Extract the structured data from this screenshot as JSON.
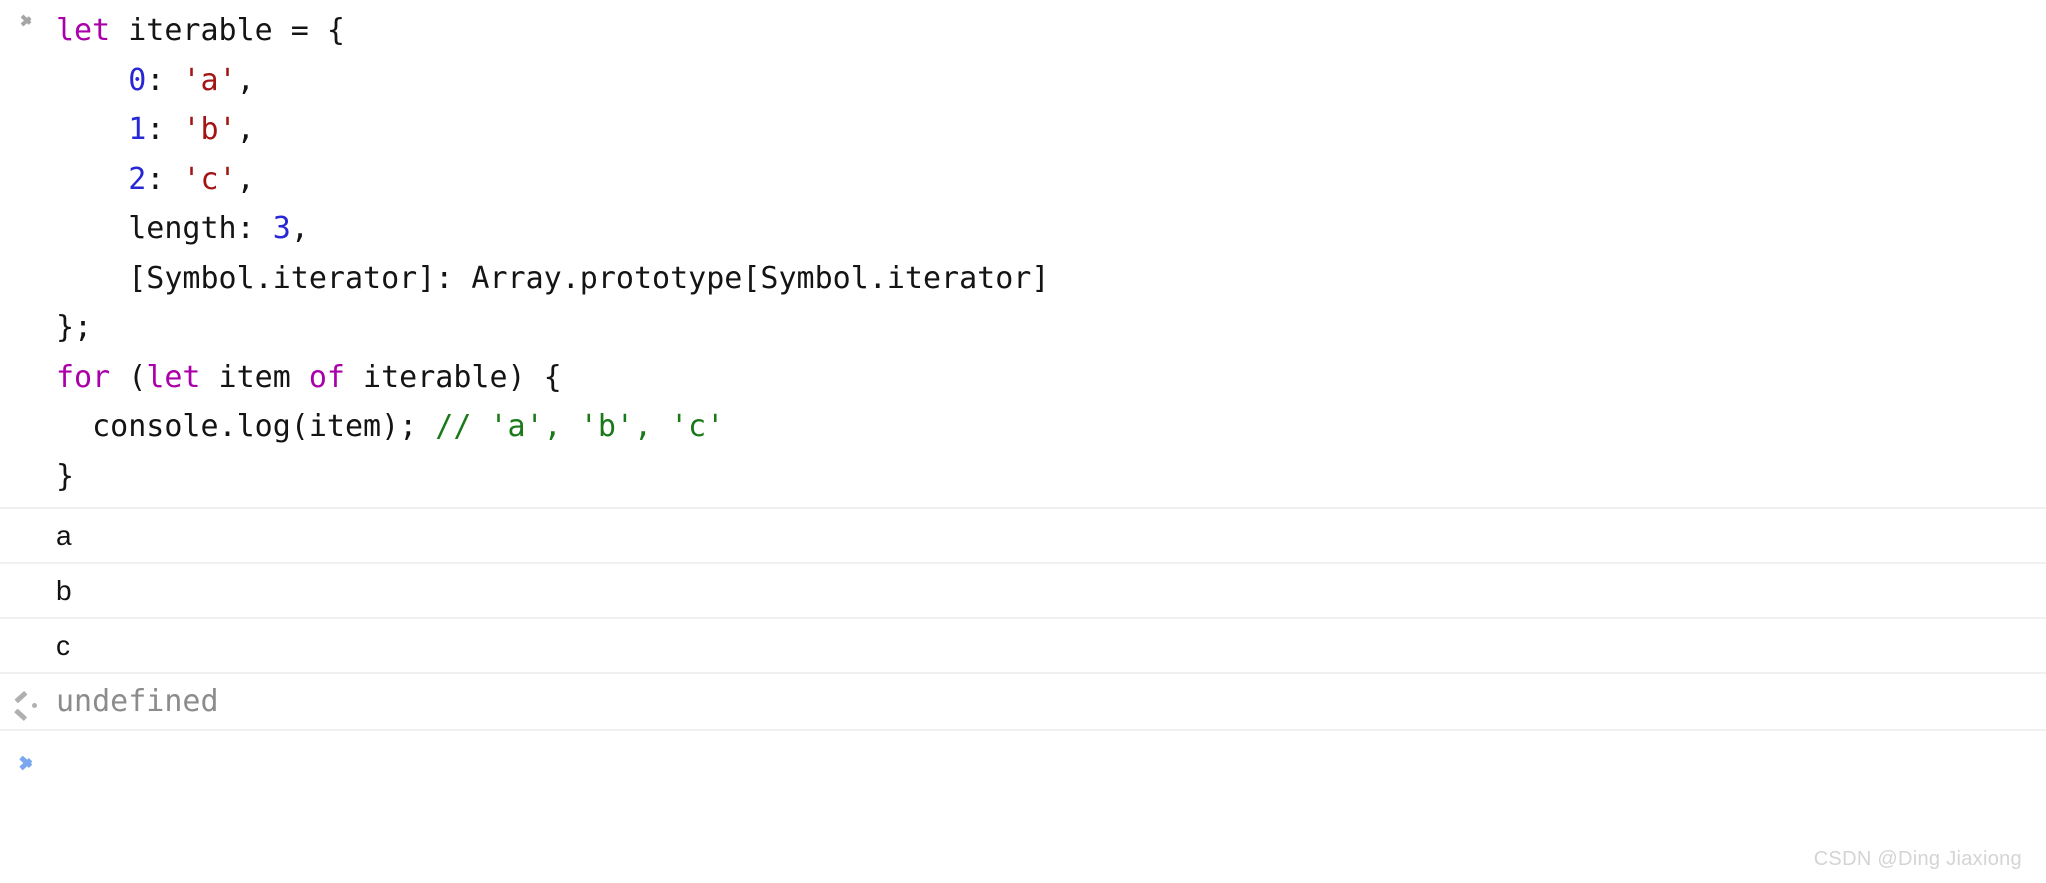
{
  "console": {
    "prompt_icon": "chevron-right-icon",
    "result_icon": "arrow-left-return-icon",
    "command_entry": {
      "icon": "chevron-right-icon",
      "lines": [
        [
          {
            "t": "let",
            "c": "keyword"
          },
          {
            "t": " iterable = {",
            "c": "plain"
          }
        ],
        [
          {
            "t": "    ",
            "c": "plain"
          },
          {
            "t": "0",
            "c": "number"
          },
          {
            "t": ": ",
            "c": "plain"
          },
          {
            "t": "'a'",
            "c": "string"
          },
          {
            "t": ",",
            "c": "plain"
          }
        ],
        [
          {
            "t": "    ",
            "c": "plain"
          },
          {
            "t": "1",
            "c": "number"
          },
          {
            "t": ": ",
            "c": "plain"
          },
          {
            "t": "'b'",
            "c": "string"
          },
          {
            "t": ",",
            "c": "plain"
          }
        ],
        [
          {
            "t": "    ",
            "c": "plain"
          },
          {
            "t": "2",
            "c": "number"
          },
          {
            "t": ": ",
            "c": "plain"
          },
          {
            "t": "'c'",
            "c": "string"
          },
          {
            "t": ",",
            "c": "plain"
          }
        ],
        [
          {
            "t": "    length: ",
            "c": "plain"
          },
          {
            "t": "3",
            "c": "number"
          },
          {
            "t": ",",
            "c": "plain"
          }
        ],
        [
          {
            "t": "    [Symbol.iterator]: Array.prototype[Symbol.iterator]",
            "c": "plain"
          }
        ],
        [
          {
            "t": "};",
            "c": "plain"
          }
        ],
        [
          {
            "t": "for",
            "c": "keyword"
          },
          {
            "t": " (",
            "c": "plain"
          },
          {
            "t": "let",
            "c": "keyword"
          },
          {
            "t": " item ",
            "c": "plain"
          },
          {
            "t": "of",
            "c": "keyword"
          },
          {
            "t": " iterable) {",
            "c": "plain"
          }
        ],
        [
          {
            "t": "  console.log(item); ",
            "c": "plain"
          },
          {
            "t": "// 'a', 'b', 'c'",
            "c": "comment"
          }
        ],
        [
          {
            "t": "}",
            "c": "plain"
          }
        ]
      ],
      "plain_text": "let iterable = {\n    0: 'a',\n    1: 'b',\n    2: 'c',\n    length: 3,\n    [Symbol.iterator]: Array.prototype[Symbol.iterator]\n};\nfor (let item of iterable) {\n  console.log(item); // 'a', 'b', 'c'\n}"
    },
    "log_entries": [
      {
        "text": "a"
      },
      {
        "text": "b"
      },
      {
        "text": "c"
      }
    ],
    "result_entry": {
      "text": "undefined"
    },
    "prompt_entry": {
      "value": "",
      "placeholder": ""
    }
  },
  "watermark": {
    "text": "CSDN @Ding Jiaxiong"
  },
  "colors": {
    "keyword": "#aa00aa",
    "number": "#2727d6",
    "string": "#a31515",
    "comment": "#1a7a1a",
    "plain": "#141414",
    "result": "#8c8c8c",
    "prompt_chevron": "#7aa7ef",
    "command_chevron": "#a6a6a6",
    "separator": "#f0f0f0",
    "background": "#ffffff"
  }
}
